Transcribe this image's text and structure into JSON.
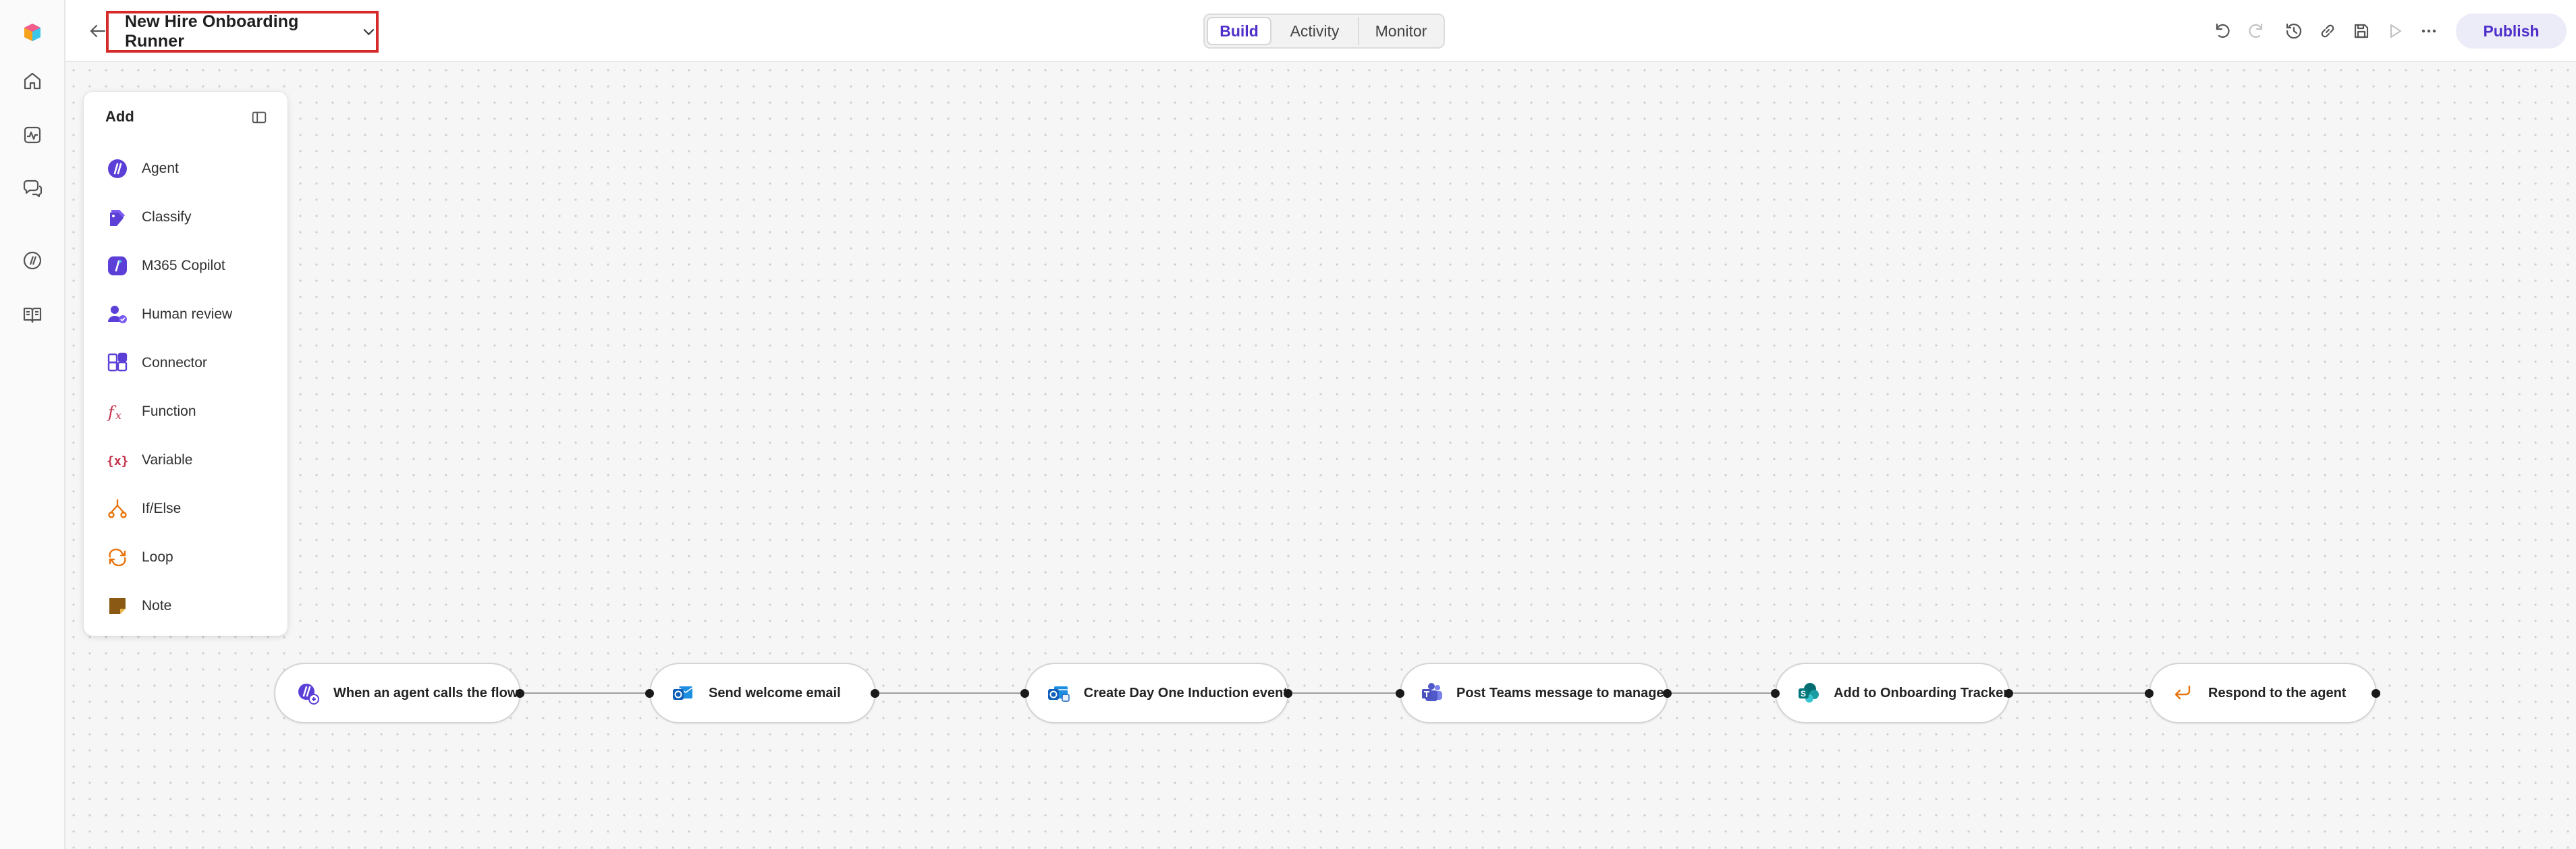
{
  "header": {
    "flow_title": "New Hire Onboarding Runner",
    "tabs": [
      {
        "label": "Build",
        "active": true
      },
      {
        "label": "Activity",
        "active": false
      },
      {
        "label": "Monitor",
        "active": false
      }
    ],
    "publish_label": "Publish",
    "toolbar_icons": [
      "undo-icon",
      "redo-icon",
      "history-icon",
      "link-icon",
      "save-icon",
      "play-icon",
      "more-icon"
    ]
  },
  "rail": {
    "icons": [
      "app-logo-icon",
      "home-icon",
      "activity-icon",
      "chat-icon",
      "agent-icon",
      "library-icon"
    ]
  },
  "add_panel": {
    "title": "Add",
    "items": [
      {
        "label": "Agent",
        "icon": "agent-icon"
      },
      {
        "label": "Classify",
        "icon": "classify-icon"
      },
      {
        "label": "M365 Copilot",
        "icon": "copilot-icon"
      },
      {
        "label": "Human review",
        "icon": "human-review-icon"
      },
      {
        "label": "Connector",
        "icon": "connector-icon"
      },
      {
        "label": "Function",
        "icon": "function-icon"
      },
      {
        "label": "Variable",
        "icon": "variable-icon"
      },
      {
        "label": "If/Else",
        "icon": "branch-icon"
      },
      {
        "label": "Loop",
        "icon": "loop-icon"
      },
      {
        "label": "Note",
        "icon": "note-icon"
      }
    ]
  },
  "flow": {
    "nodes": [
      {
        "label": "When an agent calls the flow",
        "icon": "agent-trigger-icon"
      },
      {
        "label": "Send welcome email",
        "icon": "outlook-icon"
      },
      {
        "label": "Create Day One Induction event",
        "icon": "outlook-calendar-icon"
      },
      {
        "label": "Post Teams message to manager",
        "icon": "teams-icon"
      },
      {
        "label": "Add to Onboarding Tracker",
        "icon": "sharepoint-icon"
      },
      {
        "label": "Respond to the agent",
        "icon": "respond-icon"
      }
    ]
  },
  "colors": {
    "accent": "#4f2ec9",
    "highlight_border": "#d62a2a",
    "function_red": "#c4314b",
    "loop_orange": "#e8730c"
  }
}
